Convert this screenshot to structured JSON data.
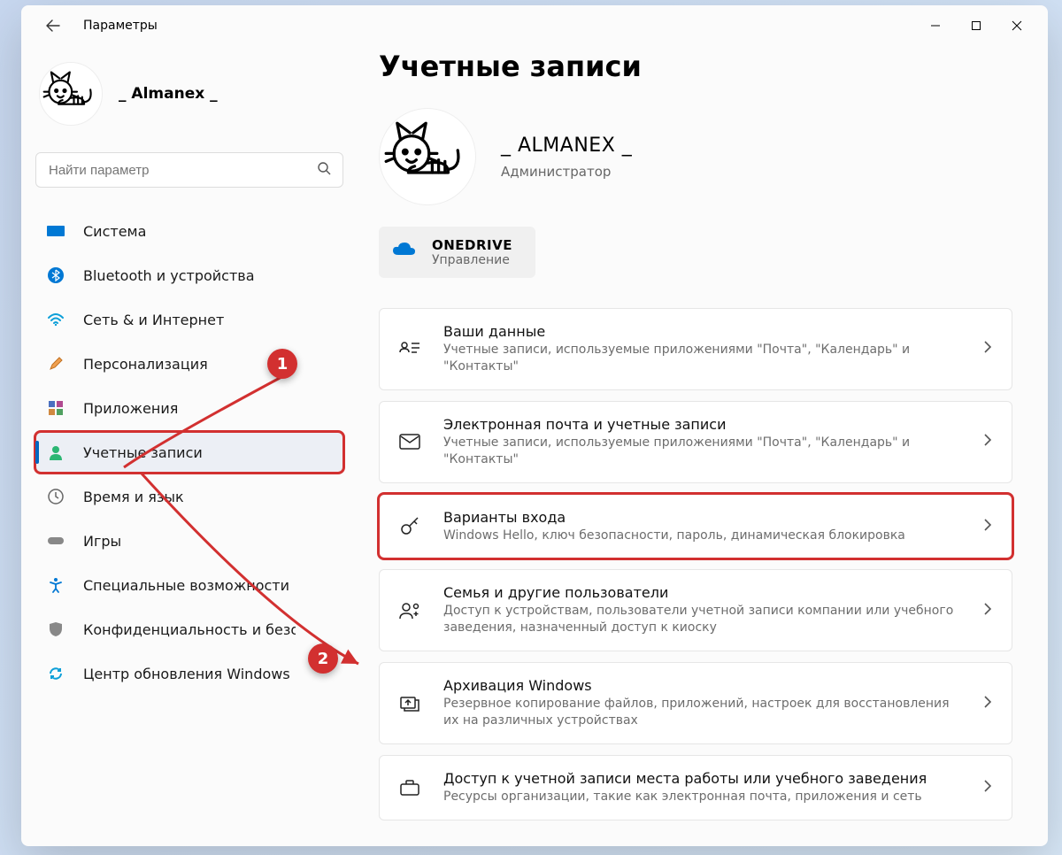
{
  "titlebar": {
    "title": "Параметры"
  },
  "sidebar": {
    "user_name": "_ Almanex _",
    "search_placeholder": "Найти параметр",
    "items": [
      {
        "label": "Система"
      },
      {
        "label": "Bluetooth и устройства"
      },
      {
        "label": "Сеть & и Интернет"
      },
      {
        "label": "Персонализация"
      },
      {
        "label": "Приложения"
      },
      {
        "label": "Учетные записи"
      },
      {
        "label": "Время и язык"
      },
      {
        "label": "Игры"
      },
      {
        "label": "Специальные возможности"
      },
      {
        "label": "Конфиденциальность и безопасность"
      },
      {
        "label": "Центр обновления Windows"
      }
    ]
  },
  "main": {
    "page_title": "Учетные записи",
    "profile_name": "_ ALMANEX _",
    "profile_role": "Администратор",
    "onedrive": {
      "title": "ONEDRIVE",
      "sub": "Управление"
    },
    "cards": [
      {
        "title": "Ваши данные",
        "sub": "Учетные записи, используемые приложениями \"Почта\", \"Календарь\" и \"Контакты\""
      },
      {
        "title": "Электронная почта и учетные записи",
        "sub": "Учетные записи, используемые приложениями \"Почта\", \"Календарь\" и \"Контакты\""
      },
      {
        "title": "Варианты входа",
        "sub": "Windows Hello, ключ безопасности, пароль, динамическая блокировка"
      },
      {
        "title": "Семья и другие пользователи",
        "sub": "Доступ к устройствам, пользователи учетной записи компании или учебного заведения, назначенный доступ к киоску"
      },
      {
        "title": "Архивация Windows",
        "sub": "Резервное копирование файлов, приложений, настроек для восстановления их на различных устройствах"
      },
      {
        "title": "Доступ к учетной записи места работы или учебного заведения",
        "sub": "Ресурсы организации, такие как электронная почта, приложения и сеть"
      }
    ]
  },
  "annotations": {
    "a1": "1",
    "a2": "2"
  }
}
